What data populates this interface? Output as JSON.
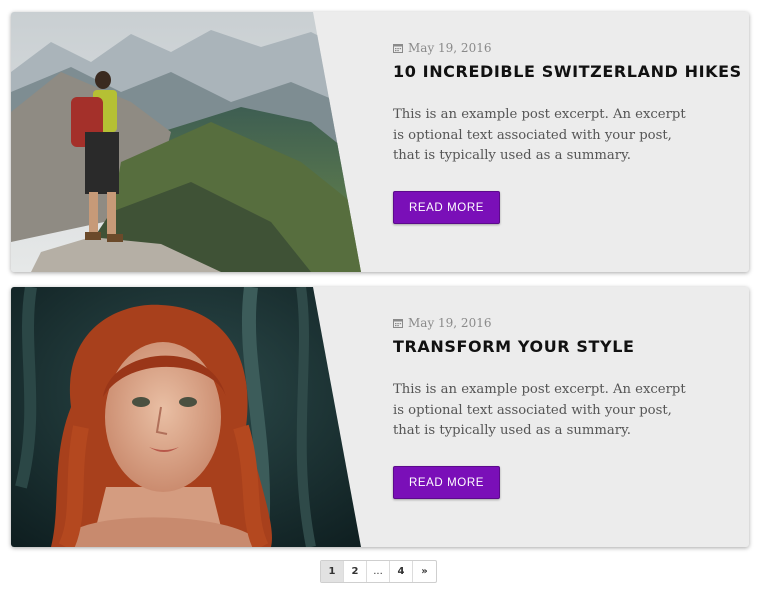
{
  "posts": [
    {
      "date": "May 19, 2016",
      "title": "10 INCREDIBLE SWITZERLAND HIKES",
      "excerpt": "This is an example post excerpt. An excerpt is optional text associated with your post, that is typically used as a summary.",
      "button_label": "READ MORE",
      "image": "hiker-on-mountain-photo"
    },
    {
      "date": "May 19, 2016",
      "title": "TRANSFORM YOUR STYLE",
      "excerpt": "This is an example post excerpt. An excerpt is optional text associated with your post, that is typically used as a summary.",
      "button_label": "READ MORE",
      "image": "red-haired-woman-portrait-photo"
    }
  ],
  "pagination": {
    "pages": [
      "1",
      "2",
      "...",
      "4",
      "»"
    ],
    "active": "1"
  },
  "colors": {
    "accent": "#7a0fb8",
    "card_bg": "#ececec"
  },
  "icons": {
    "date": "calendar-icon"
  }
}
